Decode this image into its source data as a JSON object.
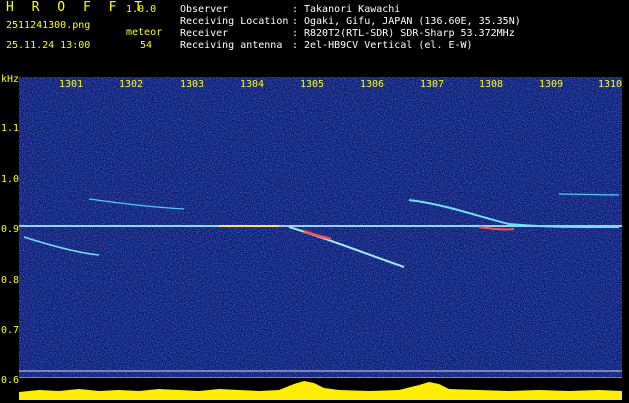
{
  "header": {
    "app_name": "H R O F F T",
    "version": "1.0.0",
    "file_name": "2511241300.png",
    "datetime": "25.11.24 13:00",
    "meteor_label": "meteor",
    "meteor_count": "54",
    "info": [
      {
        "label": "Observer",
        "value": "Takanori Kawachi"
      },
      {
        "label": "Receiving Location",
        "value": "Ogaki, Gifu, JAPAN (136.60E, 35.35N)"
      },
      {
        "label": "Receiver",
        "value": "R820T2(RTL-SDR) SDR-Sharp 53.372MHz"
      },
      {
        "label": "Receiving antenna",
        "value": "2el-HB9CV Vertical (el. E-W)"
      }
    ],
    "separator": ":"
  },
  "axis": {
    "unit": "kHz",
    "y_ticks": [
      "1.1",
      "1.0",
      "0.9",
      "0.8",
      "0.7",
      "0.6"
    ],
    "x_ticks": [
      "1301",
      "1302",
      "1303",
      "1304",
      "1305",
      "1306",
      "1307",
      "1308",
      "1309",
      "1310"
    ]
  },
  "colors": {
    "background": "#000000",
    "spectrum_bg": "#0a1a6e",
    "label_yellow": "#ffff00",
    "carrier": "#9fe8ff",
    "meteor_hot": "#ff4040"
  }
}
